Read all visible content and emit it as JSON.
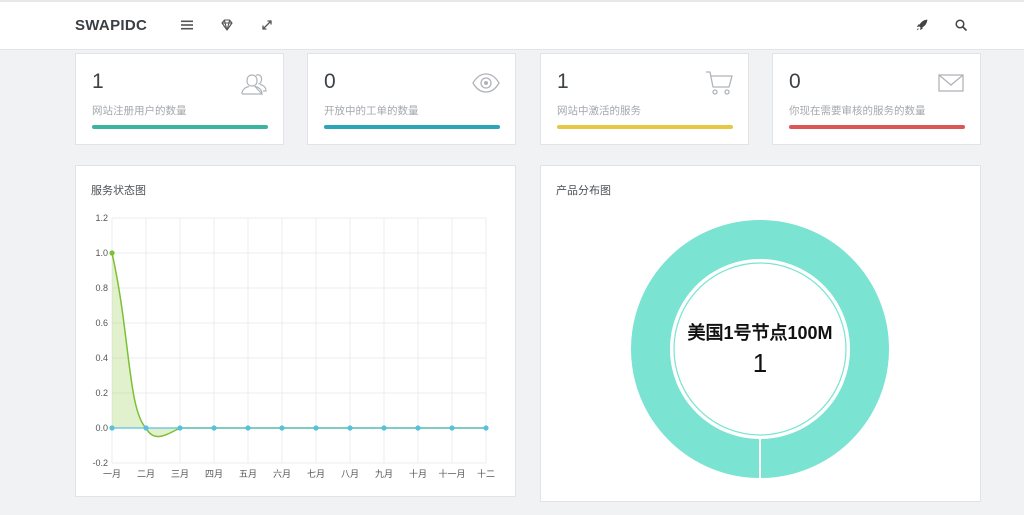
{
  "header": {
    "brand": "SWAPIDC",
    "icons": [
      "menu-icon",
      "diamond-icon",
      "fullscreen-icon",
      "rocket-icon",
      "search-icon"
    ]
  },
  "stats": [
    {
      "value": "1",
      "label": "网站注册用户的数量",
      "icon": "users-icon",
      "color": "#3cb5a0"
    },
    {
      "value": "0",
      "label": "开放中的工单的数量",
      "icon": "eye-icon",
      "color": "#2aa6b8"
    },
    {
      "value": "1",
      "label": "网站中激活的服务",
      "icon": "cart-icon",
      "color": "#e8c843"
    },
    {
      "value": "0",
      "label": "你现在需要审核的服务的数量",
      "icon": "envelope-icon",
      "color": "#dc5656"
    }
  ],
  "service_panel": {
    "title": "服务状态图"
  },
  "product_panel": {
    "title": "产品分布图"
  },
  "chart_data": [
    {
      "type": "line",
      "title": "服务状态图",
      "categories": [
        "一月",
        "二月",
        "三月",
        "四月",
        "五月",
        "六月",
        "七月",
        "八月",
        "九月",
        "十月",
        "十一月",
        "十二"
      ],
      "series": [
        {
          "values": [
            1.0,
            0,
            0,
            0,
            0,
            0,
            0,
            0,
            0,
            0,
            0,
            0
          ],
          "color": "#7cc036",
          "fill": "rgba(160,208,90,0.30)"
        },
        {
          "values": [
            0,
            0,
            0,
            0,
            0,
            0,
            0,
            0,
            0,
            0,
            0,
            0
          ],
          "color": "#5bc0de"
        }
      ],
      "ylim": [
        -0.2,
        1.2
      ],
      "yticks": [
        "1.2",
        "1.0",
        "0.8",
        "0.6",
        "0.4",
        "0.2",
        "0.0",
        "-0.2"
      ],
      "grid": true
    },
    {
      "type": "pie",
      "title": "产品分布图",
      "slices": [
        {
          "label": "美国1号节点100M",
          "value": 1,
          "color": "#7ae3d2"
        }
      ],
      "center_label": "美国1号节点100M",
      "center_value": "1"
    }
  ]
}
